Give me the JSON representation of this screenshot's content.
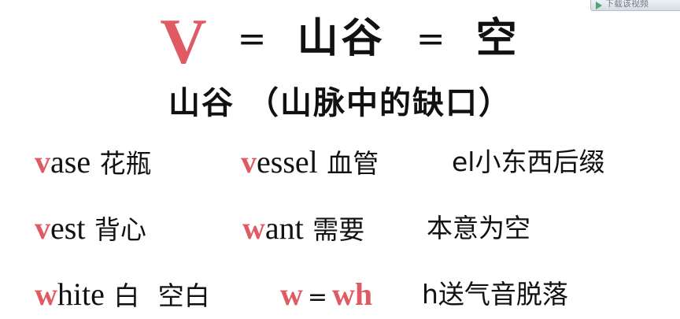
{
  "player": {
    "button_label": "下载该视频"
  },
  "title": {
    "letter": "V",
    "equals_1": "=",
    "word_1": "山谷",
    "equals_2": "=",
    "word_2": "空"
  },
  "subtitle": "山谷 （山脉中的缺口）",
  "rows": [
    [
      {
        "prefix": "v",
        "rest": "ase",
        "meaning": "花瓶"
      },
      {
        "prefix": "v",
        "rest": "essel",
        "meaning": "血管"
      },
      {
        "text": "el小东西后缀"
      }
    ],
    [
      {
        "prefix": "v",
        "rest": "est",
        "meaning": "背心"
      },
      {
        "prefix": "w",
        "rest": "ant",
        "meaning": "需要"
      },
      {
        "text": "本意为空"
      }
    ],
    [
      {
        "prefix": "w",
        "rest": "hite",
        "meaning": "白",
        "extra": "空白"
      },
      {
        "left": "w",
        "equals": "=",
        "right": "wh"
      },
      {
        "text": "h送气音脱落"
      }
    ]
  ],
  "colors": {
    "accent": "#e05a63",
    "text": "#111111",
    "background": "#ffffff"
  },
  "icons": {
    "player_button": "play-icon"
  }
}
